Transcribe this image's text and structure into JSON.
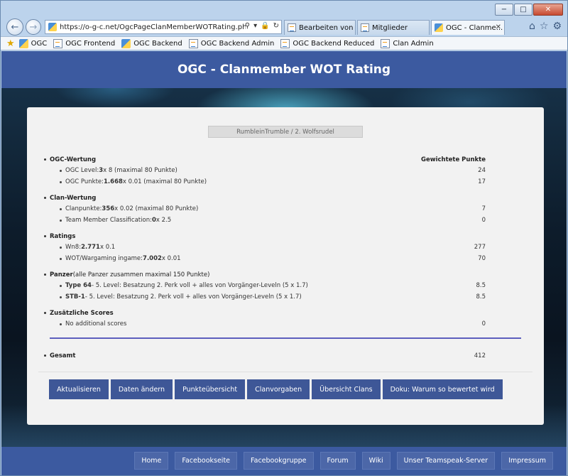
{
  "browser": {
    "window_controls": {
      "minimize": "−",
      "maximize": "□",
      "close": "✕"
    },
    "address": "https://o-g-c.net/OgcPageClanMemberWOTRating.php?UsrId=",
    "tabs": [
      {
        "label": "Bearbeiten von „..."
      },
      {
        "label": "Mitglieder"
      },
      {
        "label": "OGC - Clanme..."
      }
    ],
    "favorites": [
      {
        "label": "OGC",
        "icon": "ogc-favicon"
      },
      {
        "label": "OGC Frontend",
        "icon": "page-icon"
      },
      {
        "label": "OGC Backend",
        "icon": "ogc-favicon"
      },
      {
        "label": "OGC Backend Admin",
        "icon": "page-icon"
      },
      {
        "label": "OGC Backend Reduced",
        "icon": "page-icon"
      },
      {
        "label": "Clan Admin",
        "icon": "page-icon"
      }
    ]
  },
  "page": {
    "title": "OGC - Clanmember WOT Rating",
    "member": "RumbleinTrumble / 2. Wolfsrudel",
    "points_header": "Gewichtete Punkte",
    "sections": [
      {
        "title": "OGC-Wertung",
        "items": [
          {
            "pre": "OGC Level: ",
            "bold": "3",
            "post": " x 8 (maximal 80 Punkte)",
            "points": "24"
          },
          {
            "pre": "OGC Punkte: ",
            "bold": "1.668",
            "post": " x 0.01 (maximal 80 Punkte)",
            "points": "17"
          }
        ]
      },
      {
        "title": "Clan-Wertung",
        "items": [
          {
            "pre": "Clanpunkte: ",
            "bold": "356",
            "post": " x 0.02 (maximal 80 Punkte)",
            "points": "7"
          },
          {
            "pre": "Team Member Classification: ",
            "bold": "0",
            "post": " x 2.5",
            "points": "0"
          }
        ]
      },
      {
        "title": "Ratings",
        "items": [
          {
            "pre": "Wn8: ",
            "bold": "2.771",
            "post": " x 0.1",
            "points": "277"
          },
          {
            "pre": "WOT/Wargaming ingame: ",
            "bold": "7.002",
            "post": " x 0.01",
            "points": "70"
          }
        ]
      },
      {
        "title": "Panzer",
        "title_note": " (alle Panzer zusammen maximal 150 Punkte)",
        "items": [
          {
            "pre": "",
            "bold": "Type 64",
            "post": " - 5. Level: Besatzung 2. Perk voll + alles von Vorgänger-Leveln (5 x 1.7)",
            "points": "8.5"
          },
          {
            "pre": "",
            "bold": "STB-1",
            "post": " - 5. Level: Besatzung 2. Perk voll + alles von Vorgänger-Leveln (5 x 1.7)",
            "points": "8.5"
          }
        ]
      },
      {
        "title": "Zusätzliche Scores",
        "items": [
          {
            "pre": "No additional scores",
            "bold": "",
            "post": "",
            "points": "0"
          }
        ]
      }
    ],
    "total": {
      "label": "Gesamt",
      "points": "412"
    },
    "buttons": [
      "Aktualisieren",
      "Daten ändern",
      "Punkteübersicht",
      "Clanvorgaben",
      "Übersicht Clans",
      "Doku: Warum so bewertet wird"
    ],
    "footer_links": [
      "Home",
      "Facebookseite",
      "Facebookgruppe",
      "Forum",
      "Wiki",
      "Unser Teamspeak-Server",
      "Impressum"
    ]
  }
}
